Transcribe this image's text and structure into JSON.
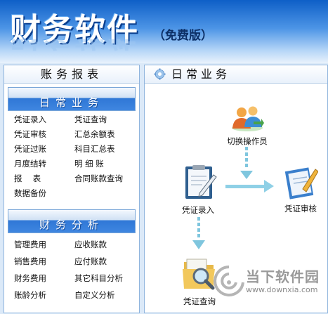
{
  "banner": {
    "title": "财务软件",
    "edition": "（免费版）"
  },
  "left_panel": {
    "title": "账务报表",
    "sections": [
      {
        "title": "日常业务",
        "items": [
          "凭证录入",
          "凭证查询",
          "凭证审核",
          "汇总余额表",
          "凭证过账",
          "科目汇总表",
          "月度结转",
          "明 细 账",
          "报　 表",
          "合同账款查询",
          "数据备份"
        ]
      },
      {
        "title": "财务分析",
        "items": [
          "管理费用",
          "应收账款",
          "销售费用",
          "应付账款",
          "财务费用",
          "其它科目分析",
          "账龄分析",
          "自定义分析"
        ]
      }
    ]
  },
  "right_panel": {
    "title": "日常业务",
    "nodes": {
      "switch_operator": "切换操作员",
      "voucher_entry": "凭证录入",
      "voucher_audit": "凭证审核",
      "voucher_query": "凭证查询"
    }
  },
  "watermark": {
    "brand": "当下软件园",
    "url": "www.downxia.com"
  },
  "colors": {
    "accent": "#2f77d6",
    "banner_top": "#0e5fc7",
    "arrow": "#7fc6de"
  }
}
